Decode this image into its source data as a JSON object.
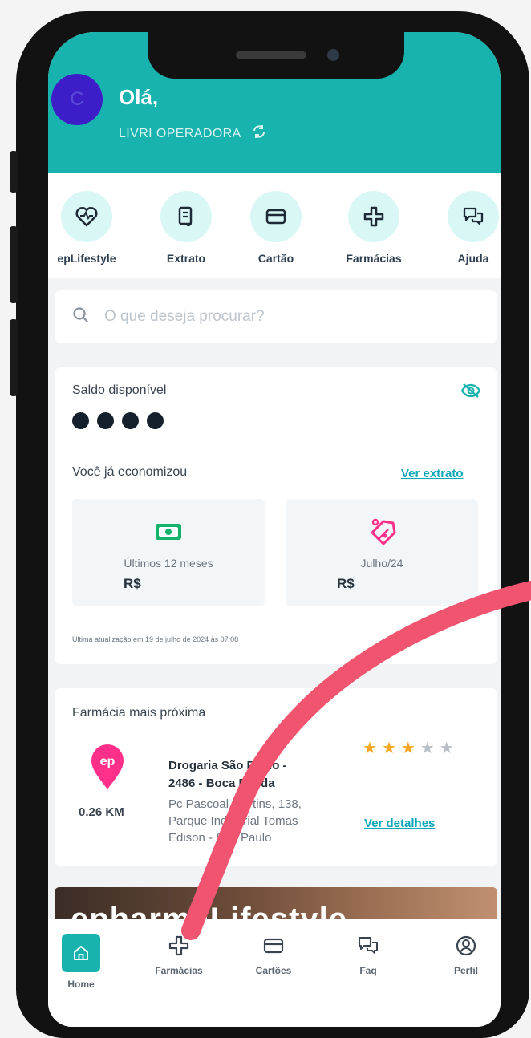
{
  "header": {
    "avatar_initial": "C",
    "greeting": "Olá,",
    "operator": "LIVRI OPERADORA"
  },
  "shortcuts": [
    {
      "label": "epLifestyle",
      "icon": "heart-pulse-icon"
    },
    {
      "label": "Extrato",
      "icon": "receipt-scroll-icon"
    },
    {
      "label": "Cartão",
      "icon": "credit-card-icon"
    },
    {
      "label": "Farmácias",
      "icon": "pharmacy-cross-icon"
    },
    {
      "label": "Ajuda",
      "icon": "chat-bubbles-icon"
    }
  ],
  "search": {
    "placeholder": "O que deseja procurar?"
  },
  "balance": {
    "title": "Saldo disponível",
    "hidden_dots": 4,
    "savings_title": "Você já economizou",
    "statement_link": "Ver extrato",
    "tiles": [
      {
        "label": "Últimos 12 meses",
        "value": "R$",
        "icon": "money-icon",
        "icon_color": "#11b26a"
      },
      {
        "label": "Julho/24",
        "value": "R$",
        "icon": "discount-tag-icon",
        "icon_color": "#ff2f8a"
      }
    ],
    "last_update": "Última atualização em 19 de julho de 2024 às 07:08"
  },
  "pharmacy": {
    "title": "Farmácia mais próxima",
    "pin_label": "ep",
    "name_line1": "Drogaria São Paulo -",
    "name_line2": "2486 - Boca Funda",
    "address_line1": "Pc Pascoal Martins, 138,",
    "address_line2": "Parque Industrial Tomas",
    "address_line3": "Edison - São Paulo",
    "distance": "0.26 KM",
    "rating": 3,
    "rating_max": 5,
    "details_link": "Ver detalhes"
  },
  "banner": {
    "text": "epharmaLifestyle"
  },
  "tabbar": [
    {
      "label": "Home",
      "icon": "home-icon",
      "active": true
    },
    {
      "label": "Farmácias",
      "icon": "pharmacy-cross-icon",
      "active": false
    },
    {
      "label": "Cartões",
      "icon": "credit-card-icon",
      "active": false
    },
    {
      "label": "Faq",
      "icon": "chat-bubbles-icon",
      "active": false
    },
    {
      "label": "Perfil",
      "icon": "user-circle-icon",
      "active": false
    }
  ],
  "colors": {
    "brand_teal": "#18b3ae",
    "link_teal": "#0aa7b8",
    "star_filled": "#f5a623",
    "star_empty": "#b8bfc6",
    "annotation_arc": "#f0546e",
    "pin_pink": "#ff2f8a"
  }
}
